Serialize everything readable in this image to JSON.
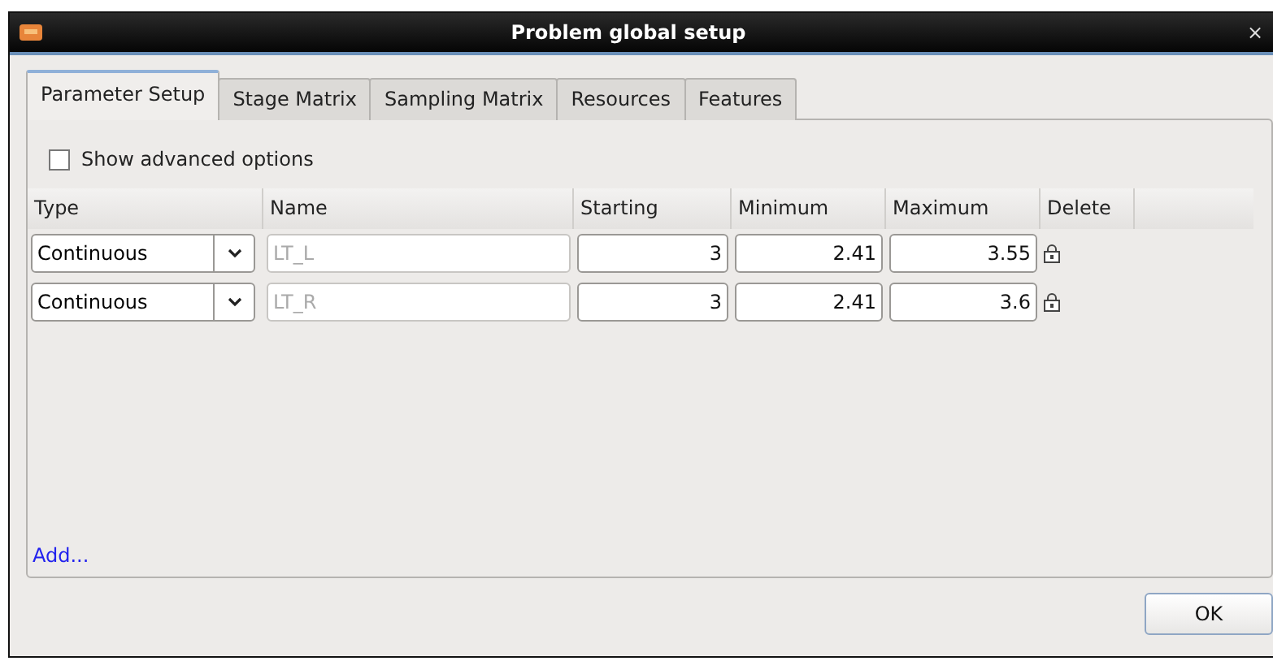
{
  "window": {
    "title": "Problem global setup",
    "close": "×"
  },
  "tabs": [
    {
      "label": "Parameter Setup",
      "selected": true
    },
    {
      "label": "Stage Matrix",
      "selected": false
    },
    {
      "label": "Sampling Matrix",
      "selected": false
    },
    {
      "label": "Resources",
      "selected": false
    },
    {
      "label": "Features",
      "selected": false
    }
  ],
  "advanced": {
    "label": "Show advanced options",
    "checked": false
  },
  "table": {
    "columns": [
      "Type",
      "Name",
      "Starting",
      "Minimum",
      "Maximum",
      "Delete"
    ],
    "rows": [
      {
        "type": "Continuous",
        "name": "LT_L",
        "starting": "3",
        "minimum": "2.41",
        "maximum": "3.55"
      },
      {
        "type": "Continuous",
        "name": "LT_R",
        "starting": "3",
        "minimum": "2.41",
        "maximum": "3.6"
      }
    ]
  },
  "add_link": "Add...",
  "buttons": [
    "OK"
  ]
}
